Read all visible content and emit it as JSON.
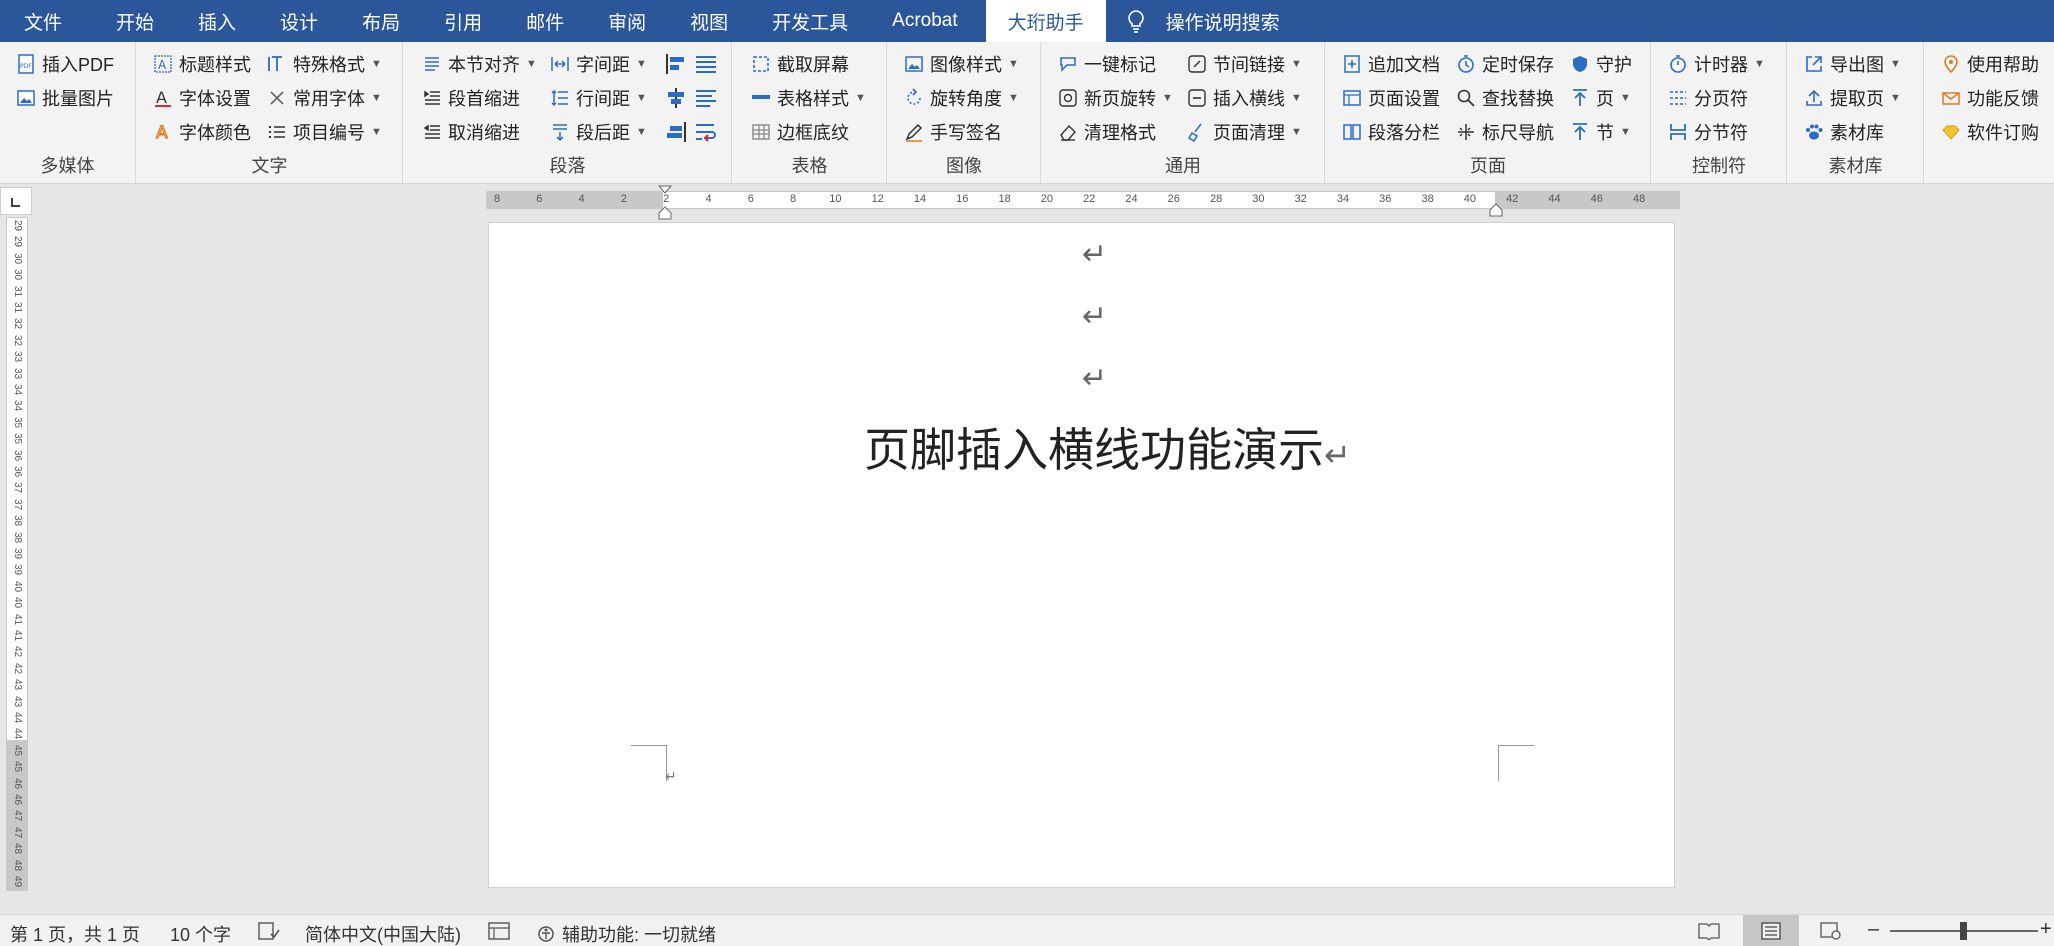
{
  "tabs": [
    "文件",
    "开始",
    "插入",
    "设计",
    "布局",
    "引用",
    "邮件",
    "审阅",
    "视图",
    "开发工具",
    "Acrobat",
    "大珩助手"
  ],
  "search_tab": "操作说明搜索",
  "colors": {
    "brand": "#2b579a",
    "ribbon_bg": "#f3f3f3",
    "icon_blue": "#2b6cc4",
    "icon_orange": "#e07a1f"
  },
  "groups": {
    "multimedia": {
      "label": "多媒体",
      "items": [
        "插入PDF",
        "批量图片"
      ]
    },
    "text": {
      "label": "文字",
      "items": [
        "标题样式",
        "特殊格式",
        "字体设置",
        "常用字体",
        "字体颜色",
        "项目编号"
      ]
    },
    "paragraph": {
      "label": "段落",
      "items": [
        "本节对齐",
        "字间距",
        "段首缩进",
        "行间距",
        "取消缩进",
        "段后距"
      ]
    },
    "table": {
      "label": "表格",
      "items": [
        "截取屏幕",
        "表格样式",
        "边框底纹"
      ]
    },
    "image": {
      "label": "图像",
      "items": [
        "图像样式",
        "旋转角度",
        "手写签名"
      ]
    },
    "general": {
      "label": "通用",
      "items": [
        "一键标记",
        "节间链接",
        "新页旋转",
        "插入横线",
        "清理格式",
        "页面清理"
      ]
    },
    "page": {
      "label": "页面",
      "items": [
        "追加文档",
        "定时保存",
        "守护",
        "页面设置",
        "查找替换",
        "页",
        "段落分栏",
        "标尺导航",
        "节"
      ]
    },
    "control": {
      "label": "控制符",
      "items": [
        "计时器",
        "分页符",
        "分节符"
      ]
    },
    "assets": {
      "label": "素材库",
      "items": [
        "导出图",
        "提取页",
        "素材库"
      ]
    },
    "help": {
      "items": [
        "使用帮助",
        "功能反馈",
        "软件订购"
      ]
    }
  },
  "ruler": {
    "h_labels": [
      "8",
      "6",
      "4",
      "2",
      "2",
      "4",
      "6",
      "8",
      "10",
      "12",
      "14",
      "16",
      "18",
      "20",
      "22",
      "24",
      "26",
      "28",
      "30",
      "32",
      "34",
      "36",
      "38",
      "40",
      "42",
      "44",
      "46",
      "48"
    ],
    "v_labels": [
      "29",
      "29",
      "30",
      "30",
      "31",
      "31",
      "32",
      "32",
      "33",
      "33",
      "34",
      "34",
      "35",
      "35",
      "36",
      "36",
      "37",
      "37",
      "38",
      "38",
      "39",
      "39",
      "40",
      "40",
      "41",
      "41",
      "42",
      "42",
      "43",
      "43",
      "44",
      "44",
      "45",
      "45",
      "46",
      "46",
      "47",
      "47",
      "48",
      "48",
      "49"
    ]
  },
  "document": {
    "title": "页脚插入横线功能演示",
    "para_mark": "↵"
  },
  "status": {
    "page": "第 1 页，共 1 页",
    "words": "10 个字",
    "language": "简体中文(中国大陆)",
    "accessibility": "辅助功能: 一切就绪",
    "zoom_minus": "–",
    "zoom_plus": "+"
  }
}
